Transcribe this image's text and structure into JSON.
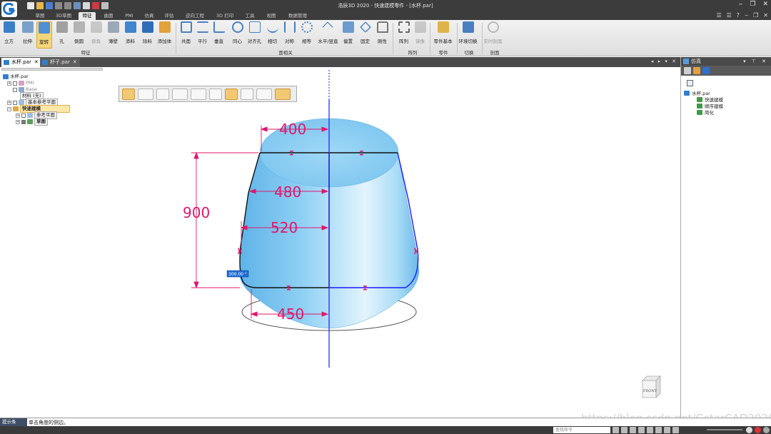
{
  "titlebar": {
    "title": "浩辰3D 2020 - 快速建模零件 - [水杯.par]"
  },
  "ribbon_tabs": [
    "草图",
    "3D草图",
    "特征",
    "曲面",
    "PMI",
    "仿真",
    "评估",
    "逆向工程",
    "3D 打印",
    "工具",
    "视图",
    "数据管理"
  ],
  "ribbon": {
    "buttons": [
      "立方",
      "拉伸",
      "旋转",
      "孔",
      "倒圆",
      "倒角",
      "薄壁",
      "添料",
      "除料",
      "添加体",
      "共面",
      "平行",
      "垂直",
      "同心",
      "对齐孔",
      "相切",
      "对称",
      "相等",
      "水平/竖直",
      "偏置",
      "固定",
      "刚性",
      "阵列",
      "镜像",
      "零件基本",
      "环境切换",
      "实时剖面"
    ],
    "groups": [
      "特征",
      "面相关",
      "阵列",
      "零件",
      "切换",
      "剖面"
    ]
  },
  "doc_tabs": [
    {
      "label": "水杯.par",
      "close": "✕"
    },
    {
      "label": "杯子.par",
      "close": "✕"
    }
  ],
  "pathfinder": {
    "root": "水杯.par",
    "pmi": "PMI",
    "base": "Base",
    "material": "材料 (无)",
    "base_planes": "基本参考平面",
    "quick_model": "快速建模",
    "ref_planes": "参考平面",
    "sketch": "草图"
  },
  "viewport": {
    "dims": {
      "d400": "400",
      "d480": "480",
      "d520": "520",
      "d900": "900",
      "d450": "450",
      "input_value": "300.00 °"
    },
    "cube_label": "FRONT"
  },
  "right_panel": {
    "title": "仿真",
    "file": "水杯.par",
    "items": [
      "快速建模",
      "顺序建模",
      "简化"
    ]
  },
  "prompt": {
    "label": "提示条",
    "text": "单击角度的侧边。"
  },
  "statusbar": {
    "command_finder": "查找命令"
  },
  "watermark": "https://blog.csdn.net/GstarCAD2020",
  "colors": {
    "accent_active": "#f7d67a",
    "dimension": "#e0176a",
    "body": "#8ecdf0",
    "axis": "#1a1aff"
  }
}
